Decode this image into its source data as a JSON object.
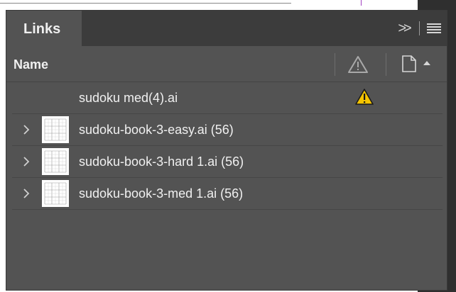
{
  "panel": {
    "tab_label": "Links",
    "collapse_glyph": ">>",
    "column_name_label": "Name"
  },
  "links": [
    {
      "label": "sudoku med(4).ai",
      "expandable": false,
      "thumbnail": false,
      "warning": true
    },
    {
      "label": "sudoku-book-3-easy.ai (56)",
      "expandable": true,
      "thumbnail": true,
      "warning": false
    },
    {
      "label": "sudoku-book-3-hard 1.ai (56)",
      "expandable": true,
      "thumbnail": true,
      "warning": false
    },
    {
      "label": "sudoku-book-3-med 1.ai (56)",
      "expandable": true,
      "thumbnail": true,
      "warning": false
    }
  ],
  "colors": {
    "panel_bg": "#535353",
    "header_bg": "#3c3c3c",
    "text": "#f0f0f0",
    "warning_yellow": "#f5c400"
  },
  "icons": {
    "collapse": "double-chevron-right-icon",
    "menu": "hamburger-menu-icon",
    "status_column": "warning-triangle-icon",
    "page_column": "document-icon",
    "sort": "sort-up-icon",
    "row_expand": "chevron-right-icon",
    "row_status": "warning-triangle-icon"
  }
}
